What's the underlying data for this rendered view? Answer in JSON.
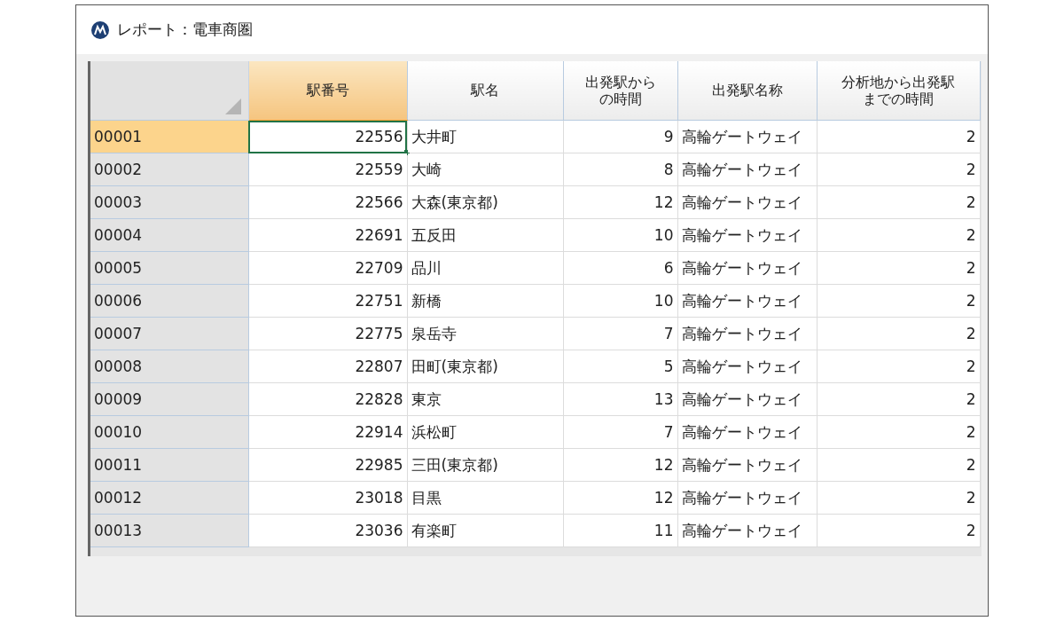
{
  "window": {
    "title": "レポート：電車商圏"
  },
  "table": {
    "columns": [
      {
        "lines": [
          "駅番号"
        ],
        "kind": "number",
        "selected": true
      },
      {
        "lines": [
          "駅名"
        ],
        "kind": "text",
        "selected": false
      },
      {
        "lines": [
          "出発駅から",
          "の時間"
        ],
        "kind": "number",
        "selected": false
      },
      {
        "lines": [
          "出発駅名称"
        ],
        "kind": "text",
        "selected": false
      },
      {
        "lines": [
          "分析地から出発駅",
          "までの時間"
        ],
        "kind": "number",
        "selected": false
      }
    ],
    "rows": [
      {
        "id": "00001",
        "selected": true,
        "cells": [
          "22556",
          "大井町",
          "9",
          "高輪ゲートウェイ",
          "2"
        ]
      },
      {
        "id": "00002",
        "selected": false,
        "cells": [
          "22559",
          "大崎",
          "8",
          "高輪ゲートウェイ",
          "2"
        ]
      },
      {
        "id": "00003",
        "selected": false,
        "cells": [
          "22566",
          "大森(東京都)",
          "12",
          "高輪ゲートウェイ",
          "2"
        ]
      },
      {
        "id": "00004",
        "selected": false,
        "cells": [
          "22691",
          "五反田",
          "10",
          "高輪ゲートウェイ",
          "2"
        ]
      },
      {
        "id": "00005",
        "selected": false,
        "cells": [
          "22709",
          "品川",
          "6",
          "高輪ゲートウェイ",
          "2"
        ]
      },
      {
        "id": "00006",
        "selected": false,
        "cells": [
          "22751",
          "新橋",
          "10",
          "高輪ゲートウェイ",
          "2"
        ]
      },
      {
        "id": "00007",
        "selected": false,
        "cells": [
          "22775",
          "泉岳寺",
          "7",
          "高輪ゲートウェイ",
          "2"
        ]
      },
      {
        "id": "00008",
        "selected": false,
        "cells": [
          "22807",
          "田町(東京都)",
          "5",
          "高輪ゲートウェイ",
          "2"
        ]
      },
      {
        "id": "00009",
        "selected": false,
        "cells": [
          "22828",
          "東京",
          "13",
          "高輪ゲートウェイ",
          "2"
        ]
      },
      {
        "id": "00010",
        "selected": false,
        "cells": [
          "22914",
          "浜松町",
          "7",
          "高輪ゲートウェイ",
          "2"
        ]
      },
      {
        "id": "00011",
        "selected": false,
        "cells": [
          "22985",
          "三田(東京都)",
          "12",
          "高輪ゲートウェイ",
          "2"
        ]
      },
      {
        "id": "00012",
        "selected": false,
        "cells": [
          "23018",
          "目黒",
          "12",
          "高輪ゲートウェイ",
          "2"
        ]
      },
      {
        "id": "00013",
        "selected": false,
        "cells": [
          "23036",
          "有楽町",
          "11",
          "高輪ゲートウェイ",
          "2"
        ]
      }
    ]
  }
}
